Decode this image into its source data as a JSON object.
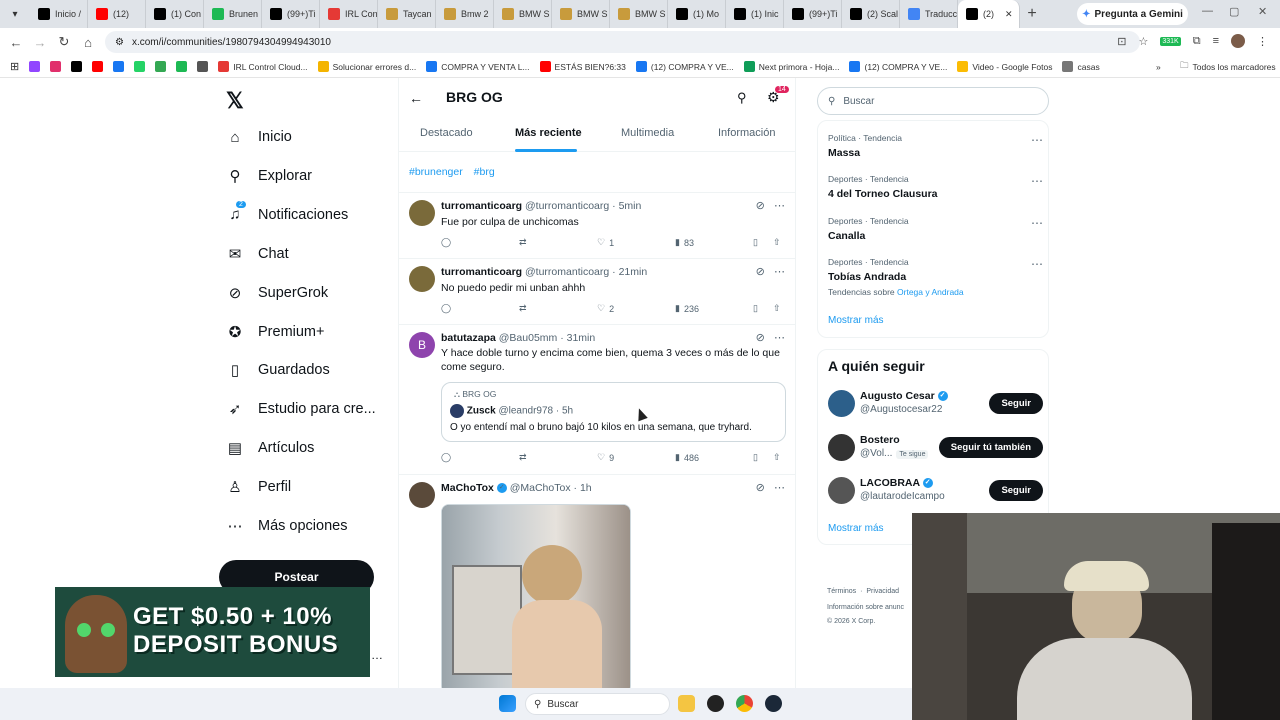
{
  "browser": {
    "tabs": [
      {
        "label": "Inicio /",
        "color": "#000000",
        "icon": "x-logo"
      },
      {
        "label": "(12)",
        "color": "#ff0000",
        "icon": "youtube"
      },
      {
        "label": "(1) Con",
        "color": "#000000",
        "icon": "x-logo"
      },
      {
        "label": "Brunen",
        "color": "#1db954",
        "icon": "kick"
      },
      {
        "label": "(99+)Ti",
        "color": "#000000",
        "icon": "tiktok"
      },
      {
        "label": "IRL Con",
        "color": "#e53935",
        "icon": "irl"
      },
      {
        "label": "Taycan",
        "color": "#c89b3c",
        "icon": "globe"
      },
      {
        "label": "Bmw 2",
        "color": "#c89b3c",
        "icon": "globe"
      },
      {
        "label": "BMW S",
        "color": "#c89b3c",
        "icon": "globe"
      },
      {
        "label": "BMW S",
        "color": "#c89b3c",
        "icon": "globe"
      },
      {
        "label": "BMW S",
        "color": "#c89b3c",
        "icon": "globe"
      },
      {
        "label": "(1) Mo",
        "color": "#000000",
        "icon": "x-logo"
      },
      {
        "label": "(1) Inic",
        "color": "#000000",
        "icon": "x-logo"
      },
      {
        "label": "(99+)Ti",
        "color": "#000000",
        "icon": "tiktok"
      },
      {
        "label": "(2) Scal",
        "color": "#000000",
        "icon": "x-logo"
      },
      {
        "label": "Traducc",
        "color": "#4285f4",
        "icon": "translate"
      },
      {
        "label": "(2)",
        "color": "#000000",
        "icon": "x-logo",
        "active": true
      }
    ],
    "gemini_label": "Pregunta a Gemini",
    "url": "x.com/i/communities/1980794304994943010",
    "ext_badge": "331K",
    "bookmarks": [
      {
        "label": "",
        "color": "#9146ff"
      },
      {
        "label": "",
        "color": "#e1306c"
      },
      {
        "label": "",
        "color": "#000000"
      },
      {
        "label": "",
        "color": "#ff0000"
      },
      {
        "label": "",
        "color": "#1877f2"
      },
      {
        "label": "",
        "color": "#25d366"
      },
      {
        "label": "",
        "color": "#34a853"
      },
      {
        "label": "",
        "color": "#1db954"
      },
      {
        "label": "",
        "color": "#555555"
      },
      {
        "label": "IRL Control Cloud...",
        "color": "#e53935"
      },
      {
        "label": "Solucionar errores d...",
        "color": "#f4b400"
      },
      {
        "label": "COMPRA Y VENTA L...",
        "color": "#1877f2"
      },
      {
        "label": "ESTÁS BIEN?6:33",
        "color": "#ff0000"
      },
      {
        "label": "(12) COMPRA Y VE...",
        "color": "#1877f2"
      },
      {
        "label": "Next primora - Hoja...",
        "color": "#0f9d58"
      },
      {
        "label": "(12) COMPRA Y VE...",
        "color": "#1877f2"
      },
      {
        "label": "Video - Google Fotos",
        "color": "#fbbc04"
      },
      {
        "label": "casas",
        "color": "#777777"
      }
    ],
    "all_bookmarks": "Todos los marcadores"
  },
  "sidebar": {
    "items": [
      {
        "label": "Inicio",
        "icon": "home-icon"
      },
      {
        "label": "Explorar",
        "icon": "search-icon"
      },
      {
        "label": "Notificaciones",
        "icon": "bell-icon",
        "badge": "2"
      },
      {
        "label": "Chat",
        "icon": "chat-icon"
      },
      {
        "label": "SuperGrok",
        "icon": "grok-icon"
      },
      {
        "label": "Premium+",
        "icon": "premium-icon"
      },
      {
        "label": "Guardados",
        "icon": "bookmark-icon"
      },
      {
        "label": "Estudio para cre...",
        "icon": "rocket-icon"
      },
      {
        "label": "Artículos",
        "icon": "article-icon"
      },
      {
        "label": "Perfil",
        "icon": "person-icon"
      },
      {
        "label": "Más opciones",
        "icon": "more-icon"
      }
    ],
    "post_label": "Postear"
  },
  "ad": {
    "line1": "GET $0.50 + 10%",
    "line2": "DEPOSIT BONUS"
  },
  "community": {
    "title": "BRG OG",
    "gear_badge": "14",
    "tabs": [
      "Destacado",
      "Más reciente",
      "Multimedia",
      "Información"
    ],
    "active_tab": "Más reciente",
    "hashtags": [
      "#brunenger",
      "#brg"
    ]
  },
  "tweets": [
    {
      "name": "turromanticoarg",
      "handle": "@turromanticoarg",
      "time": "5min",
      "text": "Fue por culpa de unchicomas",
      "likes": "1",
      "views": "83",
      "avatar_color": "#7a6a3a"
    },
    {
      "name": "turromanticoarg",
      "handle": "@turromanticoarg",
      "time": "21min",
      "text": "No puedo pedir mi unban ahhh",
      "likes": "2",
      "views": "236",
      "avatar_color": "#7a6a3a"
    },
    {
      "name": "batutazapa",
      "handle": "@Bau05mm",
      "time": "31min",
      "text": "Y hace doble turno y encima come bien, quema 3 veces o más de lo que come seguro.",
      "avatar_letter": "B",
      "avatar_color": "#8e44ad",
      "quote": {
        "community": "BRG OG",
        "name": "Zusck",
        "handle": "@leandr978",
        "time": "5h",
        "text": "O yo entendí mal o bruno bajó 10 kilos en una semana, que tryhard."
      },
      "likes": "9",
      "views": "486"
    },
    {
      "name": "MaChoTox",
      "handle": "@MaChoTox",
      "time": "1h",
      "verified": true,
      "avatar_color": "#5a4a3a"
    }
  ],
  "right": {
    "search_placeholder": "Buscar",
    "trends": [
      {
        "category": "Política · Tendencia",
        "name": "Massa"
      },
      {
        "category": "Deportes · Tendencia",
        "name": "4 del Torneo Clausura"
      },
      {
        "category": "Deportes · Tendencia",
        "name": "Canalla"
      },
      {
        "category": "Deportes · Tendencia",
        "name": "Tobías Andrada",
        "sub_prefix": "Tendencias sobre",
        "sub_link": "Ortega y Andrada"
      }
    ],
    "show_more": "Mostrar más",
    "who_to_follow_title": "A quién seguir",
    "follow": [
      {
        "name": "Augusto Cesar",
        "handle": "@Augustocesar22",
        "button": "Seguir",
        "verified": true,
        "color": "#2c5f8a"
      },
      {
        "name": "Bostero",
        "handle": "@Vol...",
        "button": "Seguir tú también",
        "follows_you": "Te sigue",
        "color": "#333333"
      },
      {
        "name": "LACOBRAA",
        "handle": "@lautarodeIcampo",
        "button": "Seguir",
        "verified": true,
        "color": "#555555"
      }
    ],
    "show_more_2": "Mostrar más",
    "footer": [
      "Términos",
      "Privacidad",
      "Información sobre anunc",
      "© 2026 X Corp."
    ]
  },
  "taskbar": {
    "search_placeholder": "Buscar"
  }
}
